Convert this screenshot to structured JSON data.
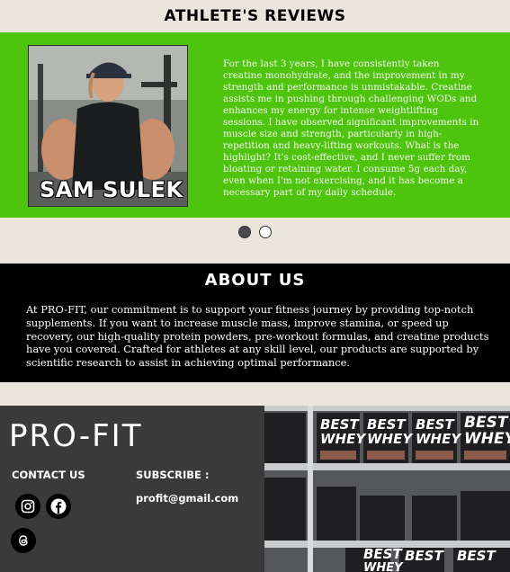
{
  "reviews": {
    "title": "ATHLETE'S REVIEWS",
    "athlete_name": "SAM SULEK",
    "text": "For the last 3 years, I have consistently taken creatine monohydrate, and the improvement in my strength and performance is unmistakable. Creatine assists me in pushing through challenging WODs and enhances my energy for intense weightlifting sessions. I have observed significant improvements in muscle size and strength, particularly in high-repetition and heavy-lifting workouts. What is the highlight? It's cost-effective, and I never suffer from bloating or retaining water. I consume 5g each day, even when I'm not exercising, and it has become a necessary part of my daily schedule.",
    "band_color": "#4fc40f",
    "carousel_active_index": 0,
    "carousel_count": 2
  },
  "about": {
    "title": "ABOUT US",
    "text": "At PRO-FIT, our commitment is to support your fitness journey by providing top-notch supplements. If you want to increase muscle mass, improve stamina, or speed up recovery, our high-quality protein powders, pre-workout formulas, and creatine products have you covered. Crafted for athletes at any skill level, our products are supported by scientific research to assist in achieving optimal performance."
  },
  "footer": {
    "logo": "PRO-FIT",
    "contact_label": "CONTACT US",
    "subscribe_label": "SUBSCRIBE :",
    "email": "profit@gmail.com",
    "social_icons": [
      "instagram-icon",
      "facebook-icon",
      "threads-icon"
    ],
    "shelf_labels": [
      "BEST",
      "WHEY"
    ]
  }
}
